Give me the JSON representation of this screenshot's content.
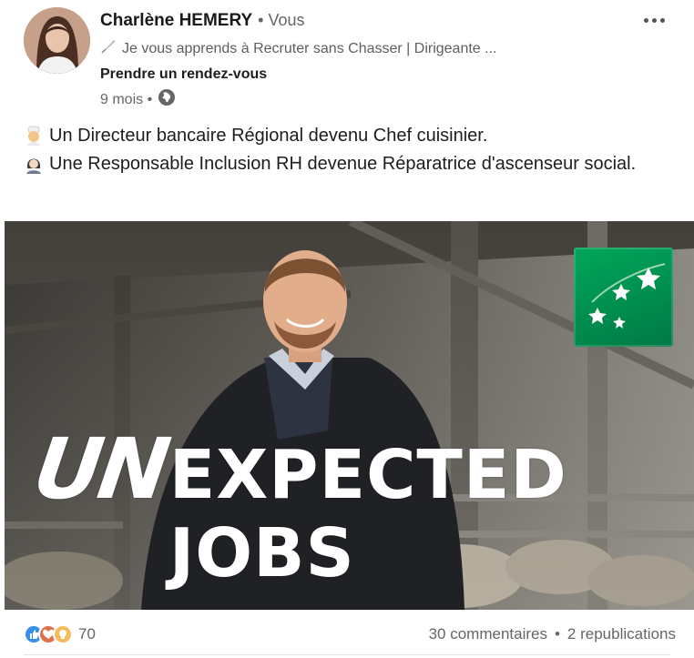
{
  "author": {
    "name": "Charlène HEMERY",
    "relation": "• Vous",
    "headline": "Je vous apprends à Recruter sans Chasser | Dirigeante ...",
    "cta": "Prendre un rendez-vous",
    "time": "9 mois •"
  },
  "post": {
    "line1": "Un Directeur bancaire Régional devenu Chef cuisinier.",
    "line2": "Une Responsable Inclusion RH devenue Réparatrice d'ascenseur social.",
    "image_title_un": "UN",
    "image_title_rest": "EXPECTED JOBS"
  },
  "footer": {
    "reaction_count": "70",
    "comments": "30 commentaires",
    "separator": "•",
    "reposts": "2 republications"
  },
  "icons": {
    "more": "more-horizontal-icon",
    "visibility": "globe-icon",
    "headline": "feather-icon",
    "line1": "chef-emoji-icon",
    "line2": "woman-office-worker-emoji-icon",
    "reactions": [
      "like-icon",
      "love-icon",
      "insightful-icon"
    ]
  },
  "colors": {
    "logo_green": "#00a65a",
    "like": "#378fe9",
    "love": "#df704d",
    "insightful": "#f5bb5c"
  }
}
